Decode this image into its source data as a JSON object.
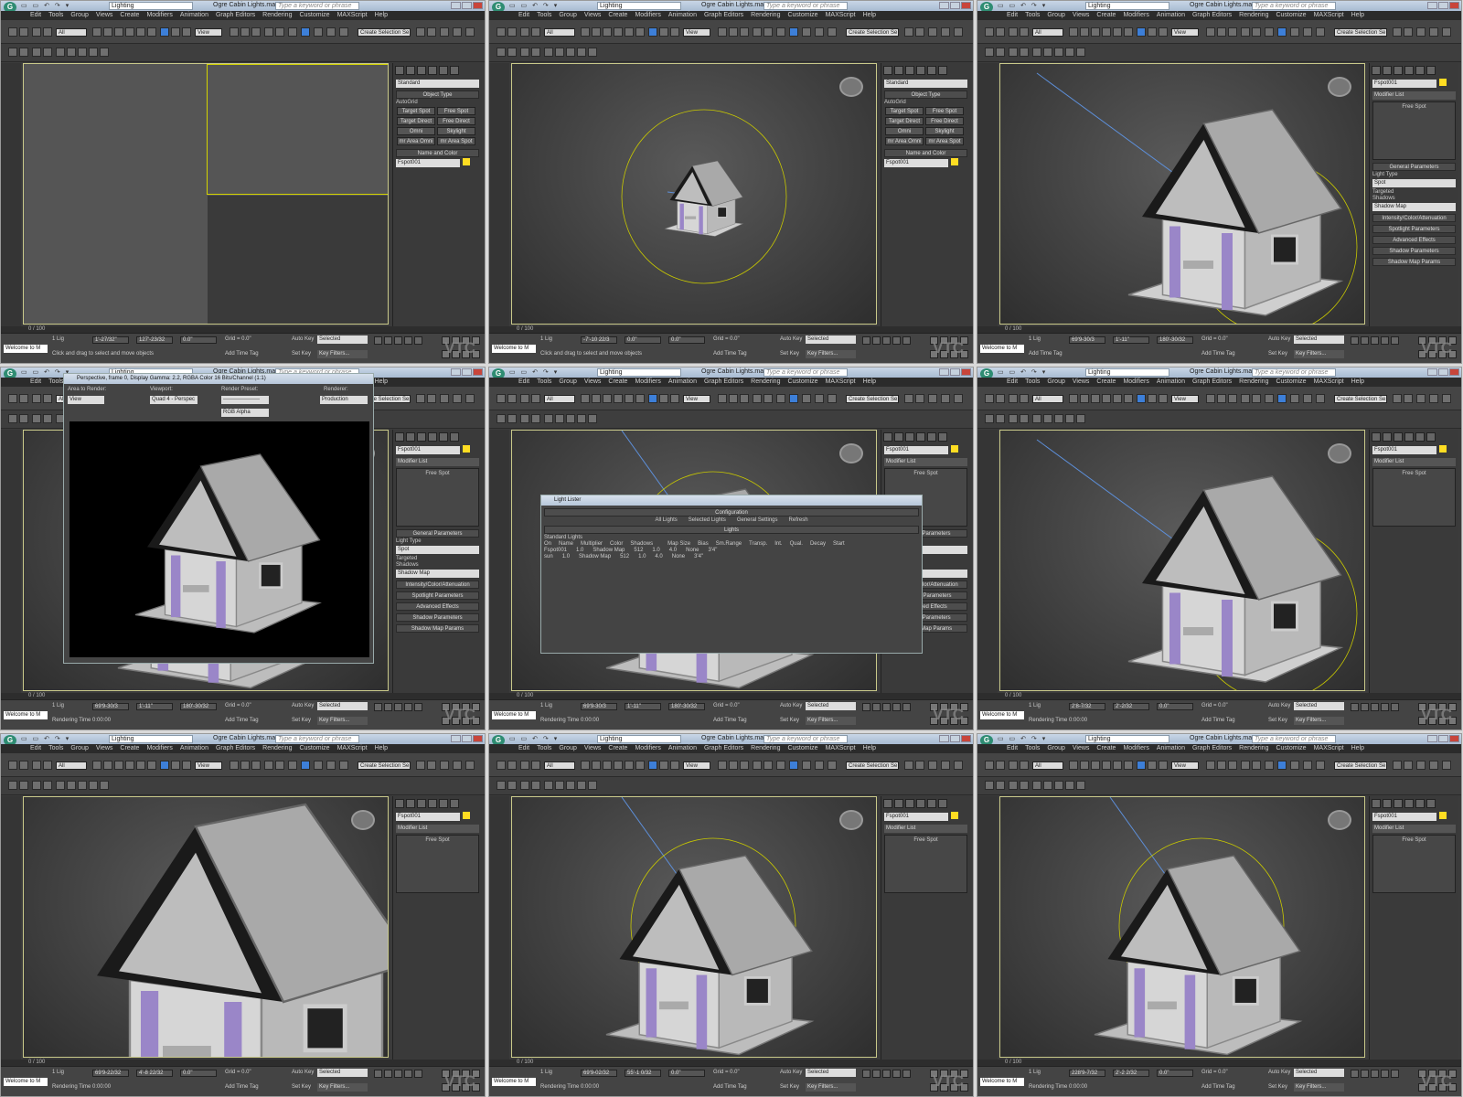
{
  "app": {
    "workspace": "Lighting",
    "document_title": "Ogre Cabin Lights.max",
    "search_placeholder": "Type a keyword or phrase",
    "menu": [
      "Edit",
      "Tools",
      "Group",
      "Views",
      "Create",
      "Modifiers",
      "Animation",
      "Graph Editors",
      "Rendering",
      "Customize",
      "MAXScript",
      "Help"
    ],
    "selection_filter": "All",
    "ref_coord": "View",
    "named_selection": "Create Selection Se",
    "frame_counter": "0 / 100",
    "welcome": "Welcome to M",
    "selection_count": "1 Lig",
    "prompt_default": "Click and drag to select and move objects",
    "prompt_render": "Rendering Time 0:00:00",
    "grid": "Grid = 0.0\"",
    "add_time_tag": "Add Time Tag",
    "auto_key": "Auto Key",
    "set_key": "Set Key",
    "key_mode": "Selected",
    "key_filters": "Key Filters...",
    "watermark": "VTC"
  },
  "panels": [
    {
      "id": "p1",
      "coords": [
        "1'-27/32\"",
        "127'-23/32",
        "0.0\""
      ],
      "prompt": "Click and drag to select and move objects",
      "cmd": "create"
    },
    {
      "id": "p2",
      "coords": [
        "-7'-10 22/3",
        "0.0\"",
        "0.0\""
      ],
      "prompt": "Click and drag to select and move objects",
      "cmd": "create"
    },
    {
      "id": "p3",
      "coords": [
        "69'9-30/3",
        "1'-11\"",
        "180'-30/32"
      ],
      "prompt": "Add Time Tag",
      "cmd": "modify"
    },
    {
      "id": "p4",
      "coords": [
        "69'9-30/3",
        "1'-11\"",
        "180'-30/32"
      ],
      "prompt": "Rendering Time 0:00:00",
      "cmd": "modify"
    },
    {
      "id": "p5",
      "coords": [
        "69'9-30/3",
        "1'-11\"",
        "180'-30/32"
      ],
      "prompt": "Rendering Time 0:00:00",
      "cmd": "modify"
    },
    {
      "id": "p6",
      "coords": [
        "2'8-7/32",
        "2'-2/32",
        "0.0\""
      ],
      "prompt": "Rendering Time 0:00:00",
      "cmd": "modify"
    },
    {
      "id": "p7",
      "coords": [
        "69'9-22/32",
        "4'-8 22/32",
        "0.0\""
      ],
      "prompt": "Rendering Time 0:00:00",
      "cmd": "modify"
    },
    {
      "id": "p8",
      "coords": [
        "69'9-02/32",
        "55'-1 0/32",
        "0.0\""
      ],
      "prompt": "Rendering Time 0:00:00",
      "cmd": "modify"
    },
    {
      "id": "p9",
      "coords": [
        "228'9-7/32",
        "2'-2 2/32",
        "0.0\""
      ],
      "prompt": "Rendering Time 0:00:00",
      "cmd": "modify"
    }
  ],
  "create_panel": {
    "dropdown": "Standard",
    "object_type_title": "Object Type",
    "autogrid": "AutoGrid",
    "buttons": [
      "Target Spot",
      "Free Spot",
      "Target Direct",
      "Free Direct",
      "Omni",
      "Skylight",
      "mr Area Omni",
      "mr Area Spot"
    ],
    "name_color_title": "Name and Color",
    "object_name": "Fspot001"
  },
  "modify_panel": {
    "object_name": "Fspot001",
    "modifier_list": "Modifier List",
    "stack_item": "Free Spot",
    "general_params": "General Parameters",
    "light_type": "Light Type",
    "on_label": "On",
    "light_type_value": "Spot",
    "targeted": "Targeted",
    "target_distance": "20'0\"",
    "shadows_title": "Shadows",
    "use_global": "Use Global Settings",
    "shadow_type": "Shadow Map",
    "exclude": "Exclude...",
    "rollouts": [
      "Intensity/Color/Attenuation",
      "Spotlight Parameters",
      "Advanced Effects",
      "Shadow Parameters",
      "Shadow Map Params",
      "Atmospheres & Effects"
    ]
  },
  "render_window": {
    "title": "Perspective, frame 0, Display Gamma: 2.2, RGBA Color 16 Bits/Channel (1:1)",
    "area_label": "Area to Render:",
    "area_value": "View",
    "viewport_label": "Viewport:",
    "viewport_value": "Quad 4 - Perspec",
    "preset_label": "Render Preset:",
    "preset_value": "--------------------",
    "renderer_label": "Renderer:",
    "renderer_value": "Production",
    "channel_value": "RGB Alpha"
  },
  "light_lister": {
    "title": "Light Lister",
    "configuration": "Configuration",
    "options": [
      "All Lights",
      "Selected Lights",
      "General Settings"
    ],
    "refresh": "Refresh",
    "lights_section": "Lights",
    "standard_lights": "Standard Lights",
    "columns": [
      "On",
      "Name",
      "Multiplier",
      "Color",
      "Shadows",
      "",
      "Map Size",
      "Bias",
      "Sm.Range",
      "Transp.",
      "Int.",
      "Qual.",
      "Decay",
      "Start"
    ],
    "rows": [
      {
        "name": "Fspot001",
        "multiplier": "1.0",
        "shadow": "Shadow Map",
        "map_size": "512",
        "bias": "1.0",
        "range": "4.0",
        "decay": "None",
        "start": "3'4\""
      },
      {
        "name": "sun",
        "multiplier": "1.0",
        "shadow": "Shadow Map",
        "map_size": "512",
        "bias": "1.0",
        "range": "4.0",
        "decay": "None",
        "start": "3'4\""
      }
    ]
  },
  "colors": {
    "accent_blue": "#3d7fd8",
    "light_color": "#ffdd22",
    "column_purple": "#9a86c8",
    "viewport_border": "#c9c98a"
  }
}
